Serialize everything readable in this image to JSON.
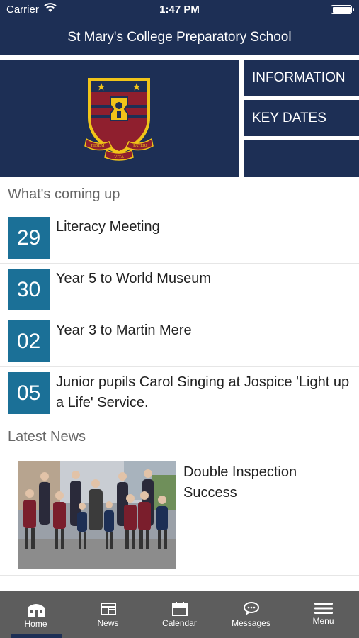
{
  "status_bar": {
    "carrier": "Carrier",
    "time": "1:47 PM",
    "wifi_icon": "wifi-icon",
    "battery_icon": "battery-icon",
    "battery_level": 1.0
  },
  "header": {
    "title": "St Mary's College Preparatory School"
  },
  "hero": {
    "logo_icon": "school-crest-logo",
    "crest_motto_left": "FIDEM",
    "crest_motto_center": "VITA",
    "crest_motto_right": "PATERI",
    "tiles": [
      {
        "label": "INFORMATION"
      },
      {
        "label": "KEY DATES"
      },
      {
        "label": ""
      }
    ]
  },
  "coming_up": {
    "title": "What's coming up",
    "events": [
      {
        "day": "29",
        "title": "Literacy Meeting"
      },
      {
        "day": "30",
        "title": "Year 5 to World Museum"
      },
      {
        "day": "02",
        "title": "Year 3 to Martin Mere"
      },
      {
        "day": "05",
        "title": "Junior pupils Carol Singing at Jospice 'Light up a Life' Service."
      }
    ]
  },
  "news": {
    "title": "Latest News",
    "items": [
      {
        "title": "Double Inspection Success",
        "photo_icon": "group-photo"
      }
    ]
  },
  "tab_bar": {
    "tabs": [
      {
        "label": "Home",
        "icon": "home-icon",
        "active": true
      },
      {
        "label": "News",
        "icon": "news-icon",
        "active": false
      },
      {
        "label": "Calendar",
        "icon": "calendar-icon",
        "active": false
      },
      {
        "label": "Messages",
        "icon": "messages-icon",
        "active": false
      },
      {
        "label": "Menu",
        "icon": "menu-icon",
        "active": false
      }
    ]
  },
  "colors": {
    "navy": "#1d2f55",
    "date_blue": "#1b7097",
    "tab_bar": "#5d5d5d",
    "crest_red": "#8f1f2e",
    "crest_gold": "#f0c419"
  }
}
